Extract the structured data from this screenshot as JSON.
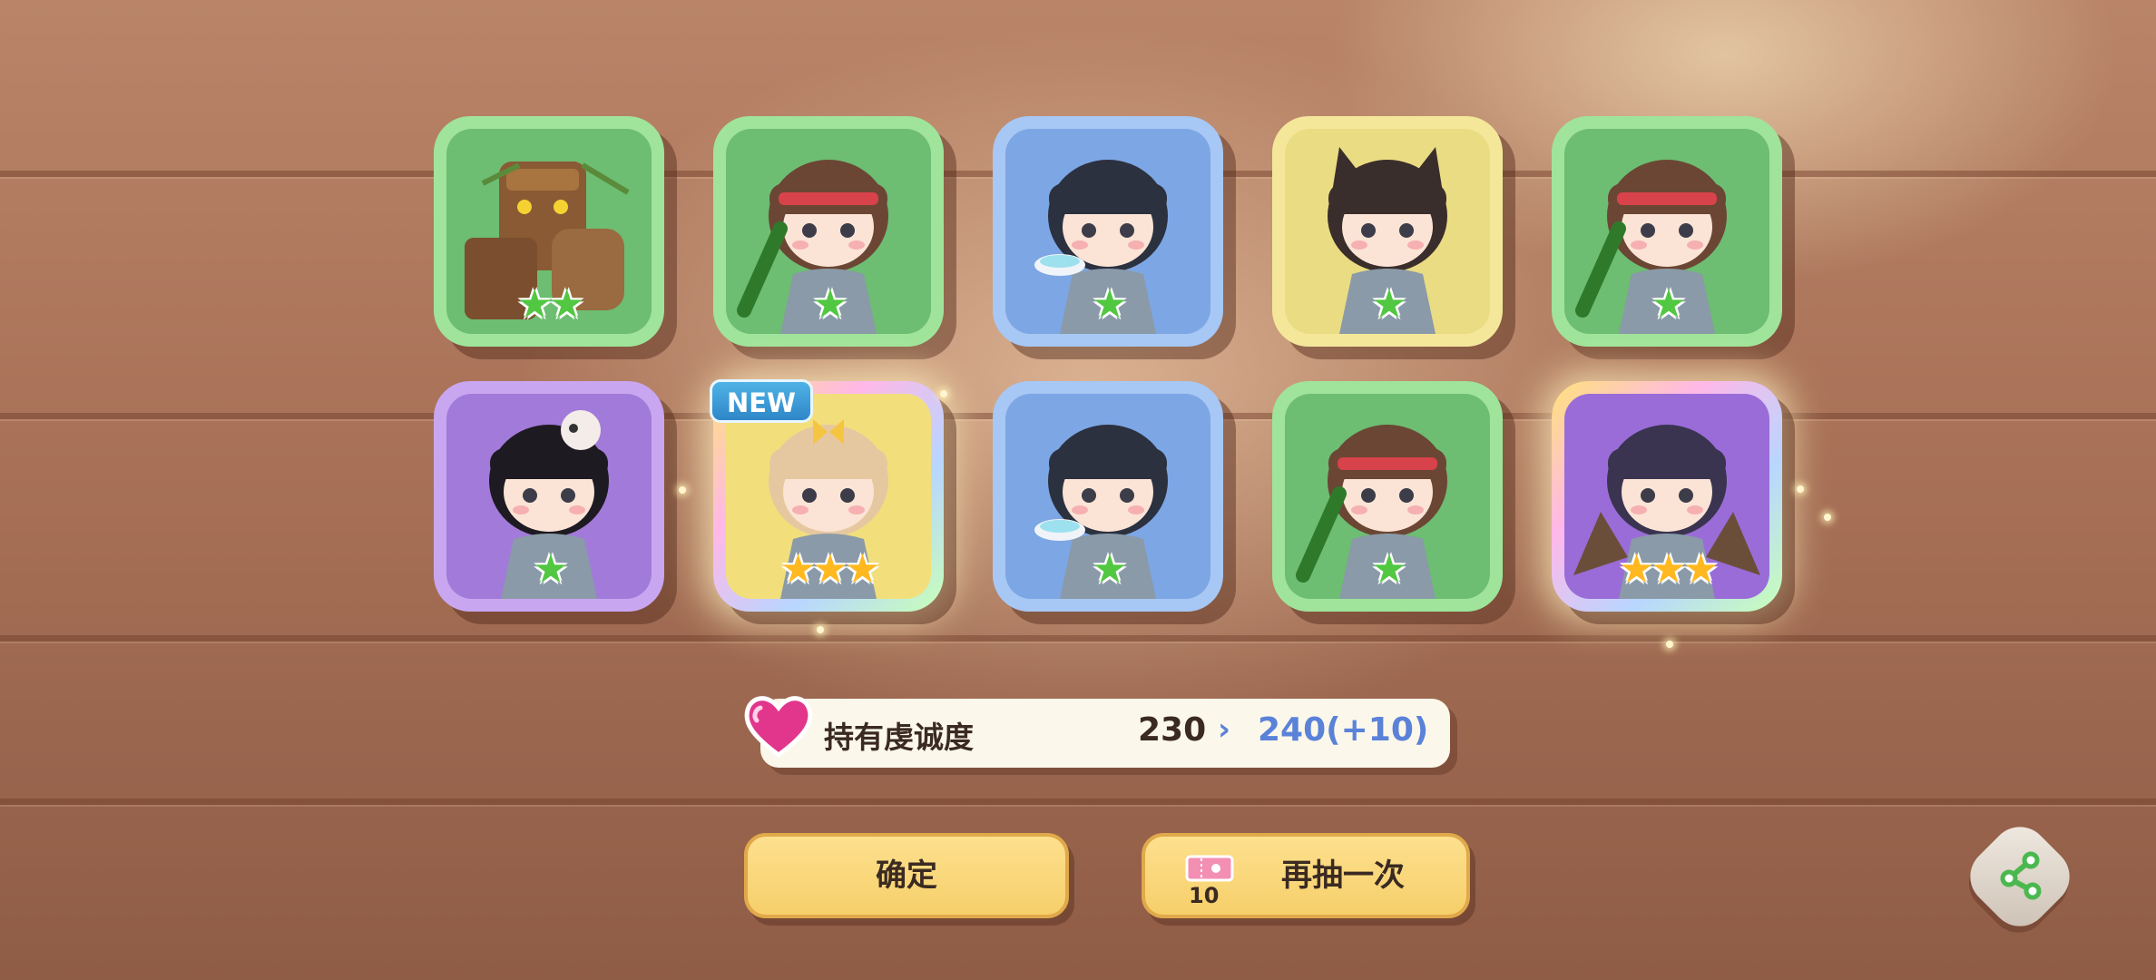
{
  "cards": [
    {
      "name": "card-treant",
      "frame": "green",
      "rarity": 2,
      "star_color": "green",
      "is_new": false
    },
    {
      "name": "card-headband-girl",
      "frame": "green",
      "rarity": 1,
      "star_color": "green",
      "is_new": false
    },
    {
      "name": "card-bowl-girl",
      "frame": "blue",
      "rarity": 1,
      "star_color": "green",
      "is_new": false
    },
    {
      "name": "card-wolf-girl",
      "frame": "yellow",
      "rarity": 1,
      "star_color": "green",
      "is_new": false
    },
    {
      "name": "card-headband-girl",
      "frame": "green",
      "rarity": 1,
      "star_color": "green",
      "is_new": false
    },
    {
      "name": "card-skull-girl",
      "frame": "purple",
      "rarity": 1,
      "star_color": "green",
      "is_new": false
    },
    {
      "name": "card-bow-girl",
      "frame": "rainbow-yellow",
      "rarity": 3,
      "star_color": "gold",
      "is_new": true
    },
    {
      "name": "card-bowl-girl",
      "frame": "blue",
      "rarity": 1,
      "star_color": "green",
      "is_new": false
    },
    {
      "name": "card-headband-girl",
      "frame": "green",
      "rarity": 1,
      "star_color": "green",
      "is_new": false
    },
    {
      "name": "card-winged-girl",
      "frame": "rainbow-purple",
      "rarity": 3,
      "star_color": "gold",
      "is_new": false
    }
  ],
  "new_badge": "NEW",
  "loyalty": {
    "label": "持有虔诚度",
    "current": "230",
    "arrow": "›",
    "new_value": "240(+10)"
  },
  "buttons": {
    "confirm": "确定",
    "draw_again": "再抽一次",
    "ticket_count": "10"
  },
  "colors": {
    "star_green": "#52c742",
    "star_gold": "#ffb81f",
    "button_yellow": "#f6cf6a",
    "loyalty_blue": "#5a82d8"
  },
  "icons": {
    "heart": "heart-icon",
    "ticket": "ticket-icon",
    "share": "share-icon"
  }
}
